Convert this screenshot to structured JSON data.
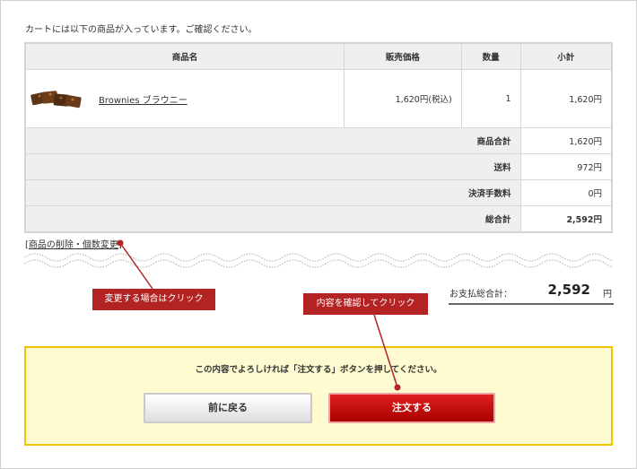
{
  "intro_text": "カートには以下の商品が入っています。ご確認ください。",
  "table": {
    "headers": {
      "name": "商品名",
      "price": "販売価格",
      "qty": "数量",
      "subtotal": "小計"
    },
    "items": [
      {
        "name": "Brownies ブラウニー",
        "price": "1,620円(税込)",
        "qty": "1",
        "subtotal": "1,620円"
      }
    ],
    "summary": [
      {
        "label": "商品合計",
        "value": "1,620円"
      },
      {
        "label": "送料",
        "value": "972円"
      },
      {
        "label": "決済手数料",
        "value": "0円"
      },
      {
        "label": "総合計",
        "value": "2,592円"
      }
    ]
  },
  "edit_link": {
    "open": "[",
    "text": "商品の削除・個数変更",
    "close": "]"
  },
  "payment_total": {
    "label": "お支払総合計：",
    "value": "2,592",
    "unit": "円"
  },
  "callouts": {
    "change": "変更する場合はクリック",
    "confirm": "内容を確認してクリック"
  },
  "confirm_box": {
    "message": "この内容でよろしければ「注文する」ボタンを押してください。",
    "back_button": "前に戻る",
    "order_button": "注文する"
  },
  "colors": {
    "callout": "#b32323",
    "order_button": "#cc0000",
    "confirm_box_bg": "#fffbd1",
    "confirm_box_border": "#f2c300"
  }
}
